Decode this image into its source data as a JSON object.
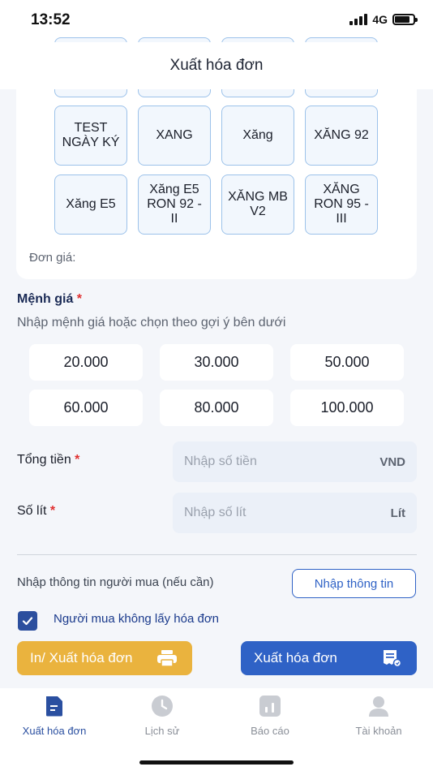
{
  "status_bar": {
    "time": "13:52",
    "network": "4G"
  },
  "header": {
    "title": "Xuất hóa đơn"
  },
  "fuel_types": {
    "items": [
      "TEST NGÀY KÝ",
      "XANG",
      "Xăng",
      "XĂNG 92",
      "Xăng E5",
      "Xăng E5 RON 92 - II",
      "XĂNG MB V2",
      "XĂNG RON 95 - III"
    ],
    "unit_price_label": "Đơn giá:"
  },
  "denomination": {
    "title": "Mệnh giá",
    "required_mark": "*",
    "hint": "Nhập mệnh giá hoặc chọn theo gợi ý bên dưới",
    "options": [
      "20.000",
      "30.000",
      "50.000",
      "60.000",
      "80.000",
      "100.000"
    ]
  },
  "total": {
    "label": "Tổng tiền",
    "required_mark": "*",
    "placeholder": "Nhập số tiền",
    "unit": "VND"
  },
  "liters": {
    "label": "Số lít",
    "required_mark": "*",
    "placeholder": "Nhập số lít",
    "unit": "Lít"
  },
  "buyer": {
    "text": "Nhập thông tin người mua (nếu cần)",
    "button_label": "Nhập thông tin"
  },
  "no_invoice": {
    "label": "Người mua không lấy hóa đơn",
    "checked": true
  },
  "actions": {
    "print_label": "In/ Xuất hóa đơn",
    "export_label": "Xuất hóa đơn"
  },
  "colors": {
    "primary": "#2f62c6",
    "print_button": "#eab33e",
    "checkbox": "#2c4f9e"
  },
  "tabbar": {
    "items": [
      {
        "label": "Xuất hóa đơn",
        "icon": "invoice-icon",
        "active": true
      },
      {
        "label": "Lịch sử",
        "icon": "clock-icon",
        "active": false
      },
      {
        "label": "Báo cáo",
        "icon": "chart-icon",
        "active": false
      },
      {
        "label": "Tài khoản",
        "icon": "user-icon",
        "active": false
      }
    ]
  }
}
